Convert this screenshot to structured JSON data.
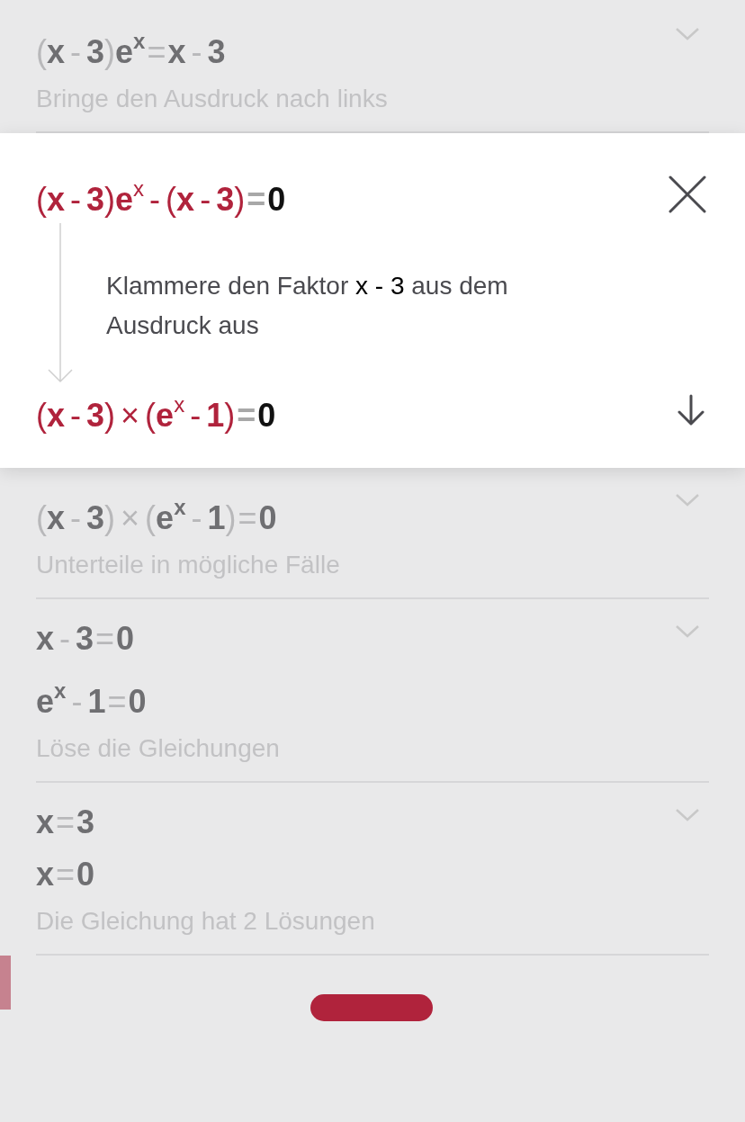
{
  "steps_before": [
    {
      "equations": [
        [
          {
            "text": "(",
            "kind": "paren"
          },
          {
            "text": "x",
            "kind": "sym"
          },
          {
            "text": "-",
            "kind": "op"
          },
          {
            "text": "3",
            "kind": "sym"
          },
          {
            "text": ")",
            "kind": "paren"
          },
          {
            "text": "e",
            "kind": "sym"
          },
          {
            "text": "x",
            "kind": "sup"
          },
          {
            "text": "=",
            "kind": "rel"
          },
          {
            "text": "x",
            "kind": "sym"
          },
          {
            "text": "-",
            "kind": "op"
          },
          {
            "text": "3",
            "kind": "sym"
          }
        ]
      ],
      "description": "Bringe den Ausdruck nach links",
      "expanded": false
    }
  ],
  "active_step": {
    "from": [
      {
        "text": "(",
        "kind": "paren",
        "highlighted": true
      },
      {
        "text": "x",
        "kind": "sym",
        "highlighted": true
      },
      {
        "text": "-",
        "kind": "op",
        "highlighted": true
      },
      {
        "text": "3",
        "kind": "sym",
        "highlighted": true
      },
      {
        "text": ")",
        "kind": "paren",
        "highlighted": true
      },
      {
        "text": "e",
        "kind": "sym",
        "highlighted": true
      },
      {
        "text": "x",
        "kind": "sup",
        "highlighted": true
      },
      {
        "text": "-",
        "kind": "op",
        "highlighted": true
      },
      {
        "text": "(",
        "kind": "paren",
        "highlighted": true
      },
      {
        "text": "x",
        "kind": "sym",
        "highlighted": true
      },
      {
        "text": "-",
        "kind": "op",
        "highlighted": true
      },
      {
        "text": "3",
        "kind": "sym",
        "highlighted": true
      },
      {
        "text": ")",
        "kind": "paren",
        "highlighted": true
      },
      {
        "text": "=",
        "kind": "rel",
        "highlighted": false
      },
      {
        "text": "0",
        "kind": "sym",
        "highlighted": false
      }
    ],
    "description": "Klammere den Faktor **x - 3** aus dem Ausdruck aus",
    "to": [
      {
        "text": "(",
        "kind": "paren",
        "highlighted": true
      },
      {
        "text": "x",
        "kind": "sym",
        "highlighted": true
      },
      {
        "text": "-",
        "kind": "op",
        "highlighted": true
      },
      {
        "text": "3",
        "kind": "sym",
        "highlighted": true
      },
      {
        "text": ")",
        "kind": "paren",
        "highlighted": true
      },
      {
        "text": "×",
        "kind": "op",
        "highlighted": true
      },
      {
        "text": "(",
        "kind": "paren",
        "highlighted": true
      },
      {
        "text": "e",
        "kind": "sym",
        "highlighted": true
      },
      {
        "text": "x",
        "kind": "sup",
        "highlighted": true
      },
      {
        "text": "-",
        "kind": "op",
        "highlighted": true
      },
      {
        "text": "1",
        "kind": "sym",
        "highlighted": true
      },
      {
        "text": ")",
        "kind": "paren",
        "highlighted": true
      },
      {
        "text": "=",
        "kind": "rel",
        "highlighted": false
      },
      {
        "text": "0",
        "kind": "sym",
        "highlighted": false
      }
    ]
  },
  "steps_after": [
    {
      "equations": [
        [
          {
            "text": "(",
            "kind": "paren"
          },
          {
            "text": "x",
            "kind": "sym"
          },
          {
            "text": "-",
            "kind": "op"
          },
          {
            "text": "3",
            "kind": "sym"
          },
          {
            "text": ")",
            "kind": "paren"
          },
          {
            "text": "×",
            "kind": "op"
          },
          {
            "text": "(",
            "kind": "paren"
          },
          {
            "text": "e",
            "kind": "sym"
          },
          {
            "text": "x",
            "kind": "sup"
          },
          {
            "text": "-",
            "kind": "op"
          },
          {
            "text": "1",
            "kind": "sym"
          },
          {
            "text": ")",
            "kind": "paren"
          },
          {
            "text": "=",
            "kind": "rel"
          },
          {
            "text": "0",
            "kind": "sym"
          }
        ]
      ],
      "description": "Unterteile in mögliche Fälle",
      "expanded": false
    },
    {
      "equations": [
        [
          {
            "text": "x",
            "kind": "sym"
          },
          {
            "text": "-",
            "kind": "op"
          },
          {
            "text": "3",
            "kind": "sym"
          },
          {
            "text": "=",
            "kind": "rel"
          },
          {
            "text": "0",
            "kind": "sym"
          }
        ],
        [
          {
            "text": "e",
            "kind": "sym"
          },
          {
            "text": "x",
            "kind": "sup"
          },
          {
            "text": "-",
            "kind": "op"
          },
          {
            "text": "1",
            "kind": "sym"
          },
          {
            "text": "=",
            "kind": "rel"
          },
          {
            "text": "0",
            "kind": "sym"
          }
        ]
      ],
      "description": "Löse die Gleichungen",
      "expanded": false
    },
    {
      "equations": [
        [
          {
            "text": "x",
            "kind": "sym"
          },
          {
            "text": "=",
            "kind": "rel"
          },
          {
            "text": "3",
            "kind": "sym"
          }
        ],
        [
          {
            "text": "x",
            "kind": "sym"
          },
          {
            "text": "=",
            "kind": "rel"
          },
          {
            "text": "0",
            "kind": "sym"
          }
        ]
      ],
      "description": "Die Gleichung hat 2 Lösungen",
      "expanded": false
    }
  ]
}
